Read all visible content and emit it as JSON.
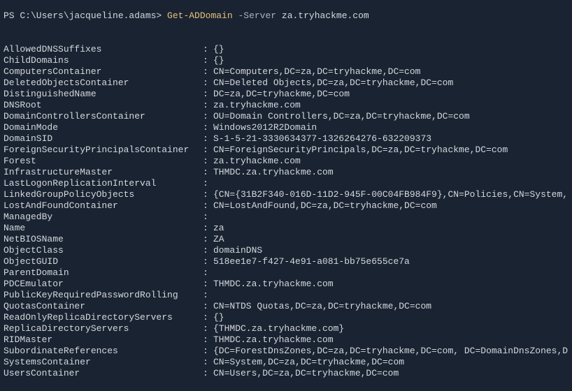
{
  "prompt": {
    "path": "PS C:\\Users\\jacqueline.adams> ",
    "cmdlet": "Get-ADDomain",
    "param": " -Server ",
    "value": "za.tryhackme.com"
  },
  "output": [
    {
      "key": "AllowedDNSSuffixes",
      "value": "{}"
    },
    {
      "key": "ChildDomains",
      "value": "{}"
    },
    {
      "key": "ComputersContainer",
      "value": "CN=Computers,DC=za,DC=tryhackme,DC=com"
    },
    {
      "key": "DeletedObjectsContainer",
      "value": "CN=Deleted Objects,DC=za,DC=tryhackme,DC=com"
    },
    {
      "key": "DistinguishedName",
      "value": "DC=za,DC=tryhackme,DC=com"
    },
    {
      "key": "DNSRoot",
      "value": "za.tryhackme.com"
    },
    {
      "key": "DomainControllersContainer",
      "value": "OU=Domain Controllers,DC=za,DC=tryhackme,DC=com"
    },
    {
      "key": "DomainMode",
      "value": "Windows2012R2Domain"
    },
    {
      "key": "DomainSID",
      "value": "S-1-5-21-3330634377-1326264276-632209373"
    },
    {
      "key": "ForeignSecurityPrincipalsContainer",
      "value": "CN=ForeignSecurityPrincipals,DC=za,DC=tryhackme,DC=com"
    },
    {
      "key": "Forest",
      "value": "za.tryhackme.com"
    },
    {
      "key": "InfrastructureMaster",
      "value": "THMDC.za.tryhackme.com"
    },
    {
      "key": "LastLogonReplicationInterval",
      "value": ""
    },
    {
      "key": "LinkedGroupPolicyObjects",
      "value": "{CN={31B2F340-016D-11D2-945F-00C04FB984F9},CN=Policies,CN=System,"
    },
    {
      "key": "LostAndFoundContainer",
      "value": "CN=LostAndFound,DC=za,DC=tryhackme,DC=com"
    },
    {
      "key": "ManagedBy",
      "value": ""
    },
    {
      "key": "Name",
      "value": "za"
    },
    {
      "key": "NetBIOSName",
      "value": "ZA"
    },
    {
      "key": "ObjectClass",
      "value": "domainDNS"
    },
    {
      "key": "ObjectGUID",
      "value": "518ee1e7-f427-4e91-a081-bb75e655ce7a"
    },
    {
      "key": "ParentDomain",
      "value": ""
    },
    {
      "key": "PDCEmulator",
      "value": "THMDC.za.tryhackme.com"
    },
    {
      "key": "PublicKeyRequiredPasswordRolling",
      "value": ""
    },
    {
      "key": "QuotasContainer",
      "value": "CN=NTDS Quotas,DC=za,DC=tryhackme,DC=com"
    },
    {
      "key": "ReadOnlyReplicaDirectoryServers",
      "value": "{}"
    },
    {
      "key": "ReplicaDirectoryServers",
      "value": "{THMDC.za.tryhackme.com}"
    },
    {
      "key": "RIDMaster",
      "value": "THMDC.za.tryhackme.com"
    },
    {
      "key": "SubordinateReferences",
      "value": "{DC=ForestDnsZones,DC=za,DC=tryhackme,DC=com, DC=DomainDnsZones,D"
    },
    {
      "key": "SystemsContainer",
      "value": "CN=System,DC=za,DC=tryhackme,DC=com"
    },
    {
      "key": "UsersContainer",
      "value": "CN=Users,DC=za,DC=tryhackme,DC=com"
    }
  ]
}
